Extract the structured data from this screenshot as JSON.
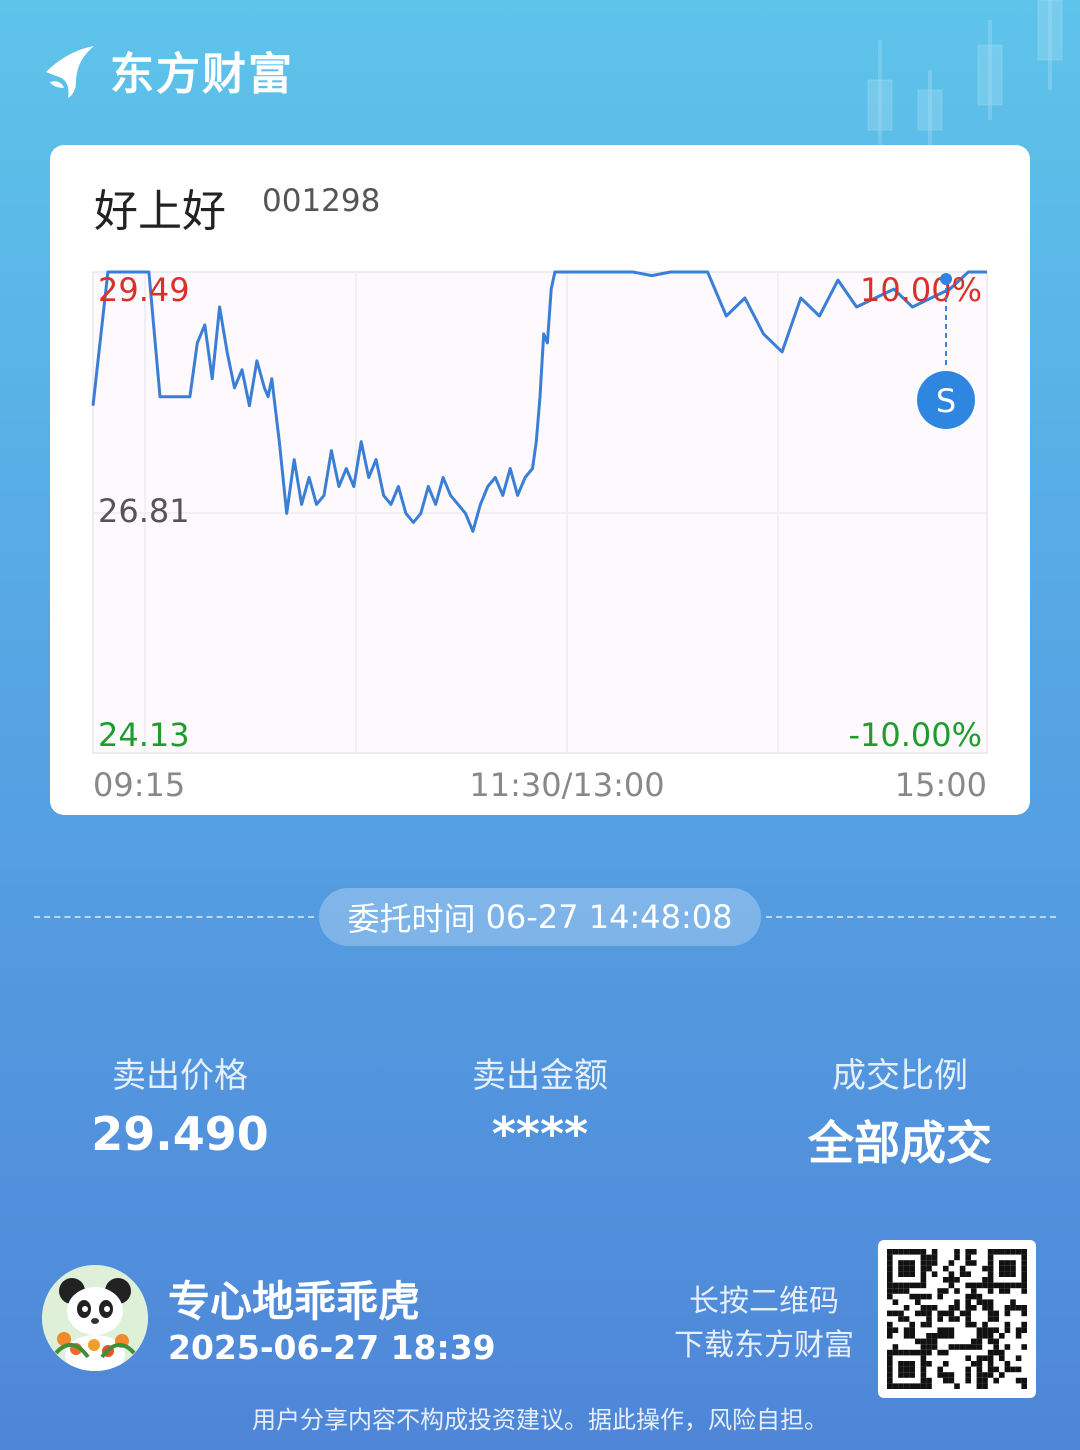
{
  "brand": {
    "name": "东方财富",
    "logo_icon": "eastmoney-logo-icon"
  },
  "stock": {
    "name": "好上好",
    "code": "001298"
  },
  "chart_data": {
    "type": "line",
    "x_ticks": [
      "09:15",
      "11:30/13:00",
      "15:00"
    ],
    "y_left_ticks": [
      "29.49",
      "26.81",
      "24.13"
    ],
    "y_right_ticks": [
      "10.00%",
      "-10.00%"
    ],
    "ylim": [
      24.13,
      29.49
    ],
    "reference_price": 26.81,
    "marker_label": "S",
    "series": [
      {
        "x": [
          0,
          4,
          8,
          12,
          15,
          18,
          20,
          22,
          24,
          26,
          28,
          30,
          32,
          34,
          36,
          38,
          40,
          42,
          44,
          46,
          47,
          48,
          50,
          52,
          54,
          56,
          58,
          60,
          62,
          64,
          66,
          68,
          70,
          72,
          74,
          76,
          78,
          80,
          82,
          84,
          86,
          88,
          90,
          92,
          94,
          96,
          98,
          100,
          102,
          104,
          106,
          108,
          110,
          112,
          114,
          116,
          118,
          119,
          120,
          121,
          122,
          123,
          124,
          125,
          126,
          128,
          130,
          135,
          140,
          145,
          150,
          155,
          160,
          165,
          170,
          175,
          180,
          185,
          190,
          195,
          200,
          205,
          210,
          215,
          220,
          225,
          230,
          235,
          240
        ],
        "values": [
          28.0,
          29.49,
          29.49,
          29.49,
          29.49,
          28.1,
          28.1,
          28.1,
          28.1,
          28.1,
          28.7,
          28.9,
          28.3,
          29.1,
          28.6,
          28.2,
          28.4,
          28.0,
          28.5,
          28.2,
          28.1,
          28.3,
          27.6,
          26.8,
          27.4,
          26.9,
          27.2,
          26.9,
          27.0,
          27.5,
          27.1,
          27.3,
          27.1,
          27.6,
          27.2,
          27.4,
          27.0,
          26.9,
          27.1,
          26.8,
          26.7,
          26.8,
          27.1,
          26.9,
          27.2,
          27.0,
          26.9,
          26.8,
          26.6,
          26.9,
          27.1,
          27.2,
          27.0,
          27.3,
          27.0,
          27.2,
          27.3,
          27.6,
          28.1,
          28.8,
          28.7,
          29.3,
          29.49,
          29.49,
          29.49,
          29.49,
          29.49,
          29.49,
          29.49,
          29.49,
          29.45,
          29.49,
          29.49,
          29.49,
          29.0,
          29.2,
          28.8,
          28.6,
          29.2,
          29.0,
          29.4,
          29.1,
          29.2,
          29.3,
          29.1,
          29.2,
          29.3,
          29.49,
          29.49
        ]
      }
    ]
  },
  "order": {
    "time_label": "委托时间",
    "time_value": "06-27 14:48:08"
  },
  "stats": [
    {
      "label": "卖出价格",
      "value": "29.490"
    },
    {
      "label": "卖出金额",
      "value": "****"
    },
    {
      "label": "成交比例",
      "value": "全部成交"
    }
  ],
  "user": {
    "name": "专心地乖乖虎",
    "time": "2025-06-27 18:39",
    "avatar_icon": "panda-avatar-icon"
  },
  "qr": {
    "hint_line1": "长按二维码",
    "hint_line2": "下载东方财富",
    "icon": "qr-code-icon"
  },
  "footer": {
    "disclaimer": "用户分享内容不构成投资建议。据此操作，风险自担。"
  },
  "colors": {
    "line": "#3a7fd5",
    "up": "#d9302c",
    "down": "#1f9c2e",
    "marker": "#2f86e0"
  }
}
